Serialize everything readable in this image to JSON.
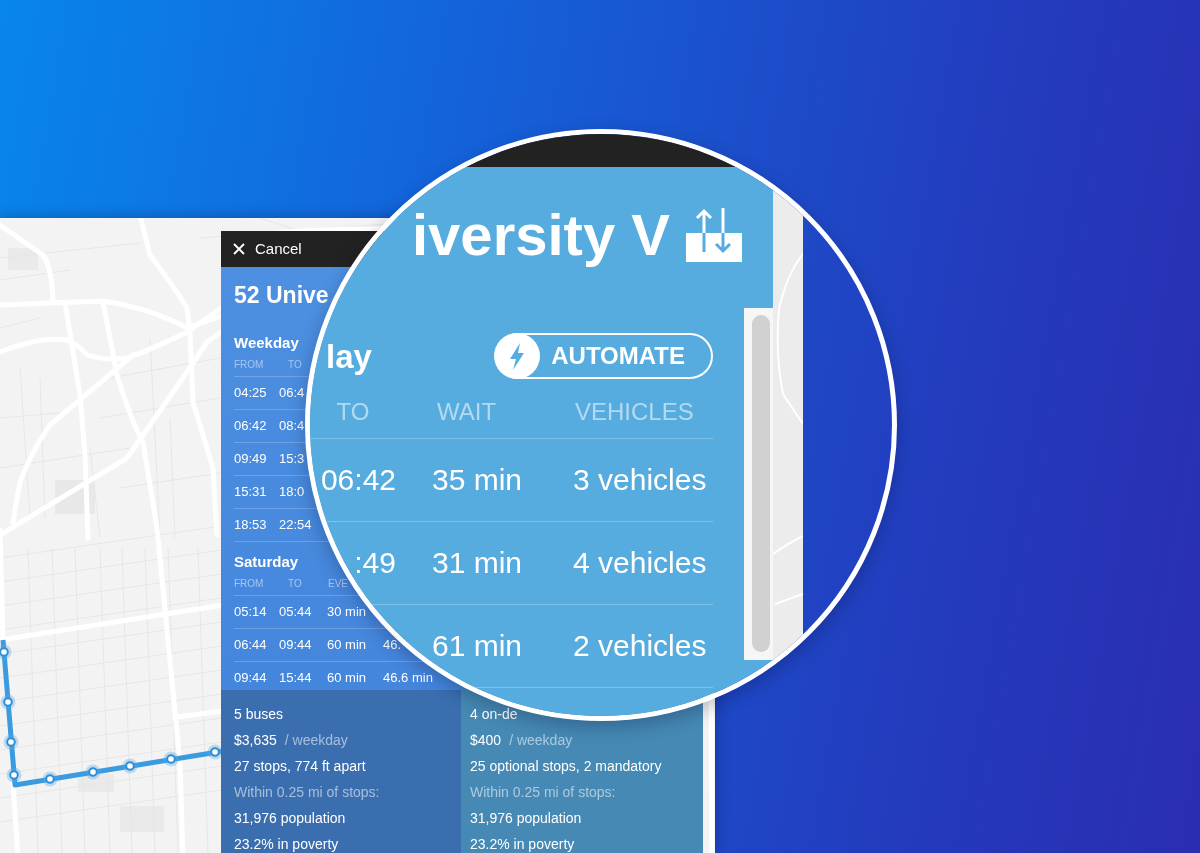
{
  "panel": {
    "cancel": "Cancel",
    "title": "52 Unive",
    "schedules": [
      {
        "day": "Weekday",
        "columns": [
          "FROM",
          "TO"
        ],
        "rows": [
          [
            "04:25",
            "06:4"
          ],
          [
            "06:42",
            "08:4"
          ],
          [
            "09:49",
            "15:3"
          ],
          [
            "15:31",
            "18:0"
          ],
          [
            "18:53",
            "22:54"
          ]
        ]
      },
      {
        "day": "Saturday",
        "columns": [
          "FROM",
          "TO",
          "EVE"
        ],
        "rows": [
          [
            "05:14",
            "05:44",
            "30 min"
          ],
          [
            "06:44",
            "09:44",
            "60 min",
            "46."
          ],
          [
            "09:44",
            "15:44",
            "60 min",
            "46.6 min"
          ]
        ]
      }
    ],
    "stats": [
      {
        "color": "#3a6eaf",
        "lines": [
          {
            "text": "5 buses",
            "muted": false
          },
          {
            "text": "$3,635",
            "unit": "/ weekday",
            "muted": false
          },
          {
            "text": "27 stops, 774 ft apart",
            "muted": false
          },
          {
            "text": "Within 0.25 mi of stops:",
            "muted": true
          },
          {
            "text": "31,976 population",
            "muted": false
          },
          {
            "text": "23.2% in poverty",
            "muted": false
          }
        ]
      },
      {
        "color": "#4589b4",
        "lines": [
          {
            "text": "4 on-de",
            "muted": false
          },
          {
            "text": "$400",
            "unit": "/ weekday",
            "muted": false
          },
          {
            "text": "25 optional stops, 2 mandatory",
            "muted": false
          },
          {
            "text": "Within 0.25 mi of stops:",
            "muted": true
          },
          {
            "text": "31,976 population",
            "muted": false
          },
          {
            "text": "23.2% in poverty",
            "muted": false
          }
        ]
      }
    ]
  },
  "lens": {
    "title": "iversity V",
    "day": "lay",
    "automate": "AUTOMATE",
    "columns": [
      "TO",
      "WAIT",
      "VEHICLES"
    ],
    "rows": [
      {
        "to": "06:42",
        "wait": "35 min",
        "vehicles": "3 vehicles"
      },
      {
        "to": ":49",
        "wait": "31 min",
        "vehicles": "4 vehicles"
      },
      {
        "wait": "61 min",
        "vehicles": "2 vehicles"
      }
    ]
  }
}
